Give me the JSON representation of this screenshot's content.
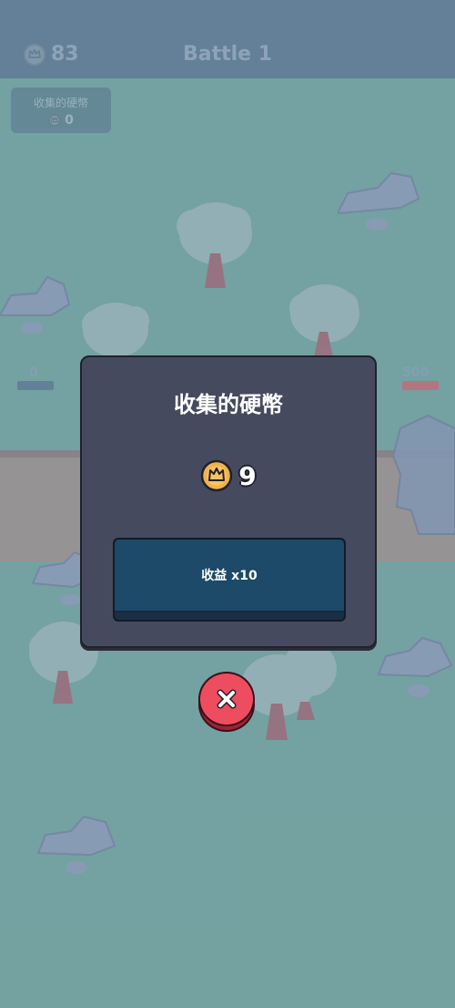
{
  "topbar": {
    "coins": "83",
    "battle_title": "Battle 1"
  },
  "coin_panel": {
    "label": "收集的硬幣",
    "count": "0"
  },
  "hp": {
    "left": "0",
    "right": "500"
  },
  "modal": {
    "title": "收集的硬幣",
    "reward_count": "9",
    "profit_button_label": "收益 x10"
  },
  "icons": {
    "crown": "crown-icon",
    "close": "close-icon"
  },
  "colors": {
    "background": "#7fb0ad",
    "topbar": "#6b8aa3",
    "modal": "#464a5f",
    "profit_button": "#1c4a68",
    "close_button": "#ee4d5f",
    "coin": "#f3b14b"
  }
}
